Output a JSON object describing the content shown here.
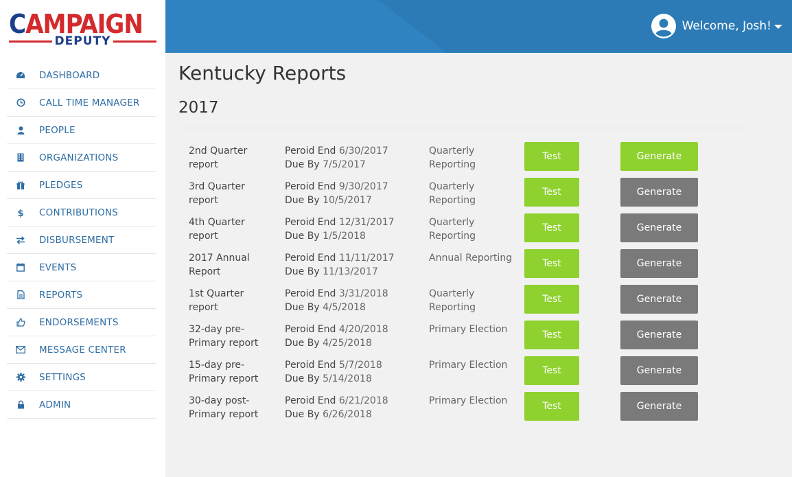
{
  "logo": {
    "top_text": "AMPAIGN",
    "check_letter": "C",
    "bottom_text": "DEPUTY"
  },
  "header": {
    "welcome": "Welcome, Josh!"
  },
  "sidebar": {
    "items": [
      {
        "label": "DASHBOARD",
        "icon": "dashboard-icon"
      },
      {
        "label": "CALL TIME MANAGER",
        "icon": "clock-icon"
      },
      {
        "label": "PEOPLE",
        "icon": "person-icon"
      },
      {
        "label": "ORGANIZATIONS",
        "icon": "building-icon"
      },
      {
        "label": "PLEDGES",
        "icon": "gift-icon"
      },
      {
        "label": "CONTRIBUTIONS",
        "icon": "dollar-icon"
      },
      {
        "label": "DISBURSEMENT",
        "icon": "exchange-icon"
      },
      {
        "label": "EVENTS",
        "icon": "calendar-icon"
      },
      {
        "label": "REPORTS",
        "icon": "document-icon"
      },
      {
        "label": "ENDORSEMENTS",
        "icon": "thumbs-up-icon"
      },
      {
        "label": "MESSAGE CENTER",
        "icon": "envelope-icon"
      },
      {
        "label": "SETTINGS",
        "icon": "gear-icon"
      },
      {
        "label": "ADMIN",
        "icon": "lock-icon"
      }
    ]
  },
  "main": {
    "title": "Kentucky Reports",
    "year": "2017",
    "period_key": "Peroid End",
    "due_key": "Due By",
    "test_label": "Test",
    "generate_label": "Generate",
    "reports": [
      {
        "name": "2nd Quarter report",
        "period_end": "6/30/2017",
        "due_by": "7/5/2017",
        "type": "Quarterly Reporting",
        "generate_active": true
      },
      {
        "name": "3rd Quarter report",
        "period_end": "9/30/2017",
        "due_by": "10/5/2017",
        "type": "Quarterly Reporting",
        "generate_active": false
      },
      {
        "name": "4th Quarter report",
        "period_end": "12/31/2017",
        "due_by": "1/5/2018",
        "type": "Quarterly Reporting",
        "generate_active": false
      },
      {
        "name": "2017 Annual Report",
        "period_end": "11/11/2017",
        "due_by": "11/13/2017",
        "type": "Annual Reporting",
        "generate_active": false
      },
      {
        "name": "1st Quarter report",
        "period_end": "3/31/2018",
        "due_by": "4/5/2018",
        "type": "Quarterly Reporting",
        "generate_active": false
      },
      {
        "name": "32-day pre-Primary report",
        "period_end": "4/20/2018",
        "due_by": "4/25/2018",
        "type": "Primary Election",
        "generate_active": false
      },
      {
        "name": "15-day pre-Primary report",
        "period_end": "5/7/2018",
        "due_by": "5/14/2018",
        "type": "Primary Election",
        "generate_active": false
      },
      {
        "name": "30-day post-Primary report",
        "period_end": "6/21/2018",
        "due_by": "6/26/2018",
        "type": "Primary Election",
        "generate_active": false
      }
    ]
  },
  "colors": {
    "header_blue": "#2c7bb6",
    "nav_text": "#2e6da4",
    "button_green": "#8fd12f",
    "button_gray": "#7a7a7a",
    "logo_red": "#d42a2c",
    "logo_blue": "#1b3f8c"
  }
}
